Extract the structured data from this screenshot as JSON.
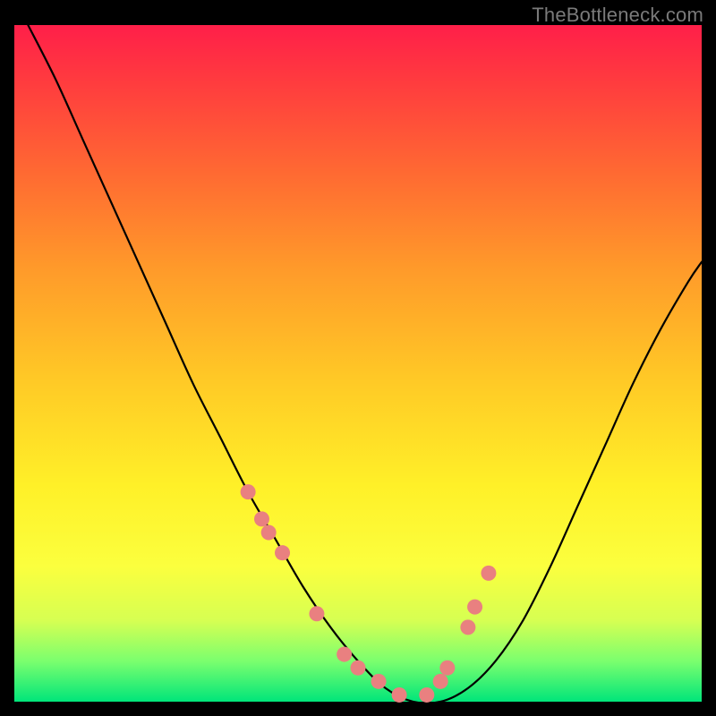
{
  "attribution": "TheBottleneck.com",
  "chart_data": {
    "type": "line",
    "title": "",
    "xlabel": "",
    "ylabel": "",
    "xlim": [
      0,
      100
    ],
    "ylim": [
      0,
      100
    ],
    "series": [
      {
        "name": "bottleneck-curve",
        "x": [
          2,
          6,
          10,
          14,
          18,
          22,
          26,
          30,
          34,
          38,
          42,
          46,
          50,
          54,
          58,
          62,
          66,
          70,
          74,
          78,
          82,
          86,
          90,
          94,
          98,
          100
        ],
        "y": [
          100,
          92,
          83,
          74,
          65,
          56,
          47,
          39,
          31,
          24,
          17,
          11,
          6,
          2,
          0,
          0,
          2,
          6,
          12,
          20,
          29,
          38,
          47,
          55,
          62,
          65
        ]
      }
    ],
    "markers": {
      "name": "highlight-points",
      "color": "#e98080",
      "x": [
        34,
        36,
        37,
        39,
        44,
        48,
        50,
        53,
        56,
        60,
        62,
        63,
        66,
        67,
        69
      ],
      "y": [
        31,
        27,
        25,
        22,
        13,
        7,
        5,
        3,
        1,
        1,
        3,
        5,
        11,
        14,
        19
      ]
    },
    "background_gradient": {
      "top": "#ff1f49",
      "mid": "#fff028",
      "bottom": "#00e57a"
    }
  }
}
